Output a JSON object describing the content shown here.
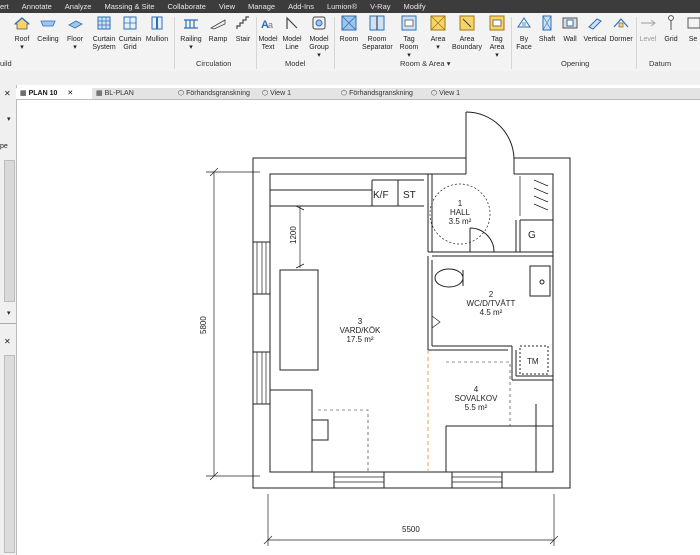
{
  "menu": [
    "ert",
    "Annotate",
    "Analyze",
    "Massing & Site",
    "Collaborate",
    "View",
    "Manage",
    "Add-Ins",
    "Lumion®",
    "V-Ray",
    "Modify"
  ],
  "ribbon": {
    "buttons": [
      {
        "id": "roof",
        "label": "Roof"
      },
      {
        "id": "ceiling",
        "label": "Ceiling"
      },
      {
        "id": "floor",
        "label": "Floor"
      },
      {
        "id": "curtain_system",
        "label": "Curtain System"
      },
      {
        "id": "curtain_grid",
        "label": "Curtain Grid"
      },
      {
        "id": "mullion",
        "label": "Mullion"
      },
      {
        "id": "railing",
        "label": "Railing"
      },
      {
        "id": "ramp",
        "label": "Ramp"
      },
      {
        "id": "stair",
        "label": "Stair"
      },
      {
        "id": "model_text",
        "label": "Model Text"
      },
      {
        "id": "model_line",
        "label": "Model Line"
      },
      {
        "id": "model_group",
        "label": "Model Group"
      },
      {
        "id": "room",
        "label": "Room"
      },
      {
        "id": "room_separator",
        "label": "Room Separator"
      },
      {
        "id": "tag_room",
        "label": "Tag Room"
      },
      {
        "id": "area",
        "label": "Area"
      },
      {
        "id": "area_boundary",
        "label": "Area Boundary"
      },
      {
        "id": "tag_area",
        "label": "Tag Area"
      },
      {
        "id": "by_face",
        "label": "By Face"
      },
      {
        "id": "shaft",
        "label": "Shaft"
      },
      {
        "id": "wall",
        "label": "Wall"
      },
      {
        "id": "vertical",
        "label": "Vertical"
      },
      {
        "id": "dormer",
        "label": "Dormer"
      },
      {
        "id": "level",
        "label": "Level"
      },
      {
        "id": "grid",
        "label": "Grid"
      },
      {
        "id": "set",
        "label": "Se"
      }
    ],
    "groups": {
      "build": "uild",
      "circulation": "Circulation",
      "model": "Model",
      "room_area": "Room & Area",
      "opening": "Opening",
      "datum": "Datum"
    }
  },
  "tabs": [
    "PLAN 10",
    "BL-PLAN",
    "Förhandsgranskning",
    "View 1",
    "Förhandsgranskning",
    "View 1"
  ],
  "left_panel": {
    "label": "pe"
  },
  "plan": {
    "rooms": [
      {
        "number": "1",
        "name": "HALL",
        "area": "3.5 m²"
      },
      {
        "number": "2",
        "name": "WC/D/TVÄTT",
        "area": "4.5 m²"
      },
      {
        "number": "3",
        "name": "VARD/KÖK",
        "area": "17.5 m²"
      },
      {
        "number": "4",
        "name": "SOVALKOV",
        "area": "5.5 m²"
      }
    ],
    "labels": {
      "kf": "K/F",
      "st": "ST",
      "g": "G",
      "tm": "TM"
    },
    "dimensions": {
      "width": "5500",
      "height": "5800",
      "kitchen_depth": "1200"
    }
  },
  "colors": {
    "menubar": "#3c3c3c",
    "ribbon": "#f3f3f3",
    "wall": "#222222",
    "accent_orange": "#f0a040",
    "icon_yellow": "#f7d36a",
    "icon_blue": "#2f6fb5"
  }
}
